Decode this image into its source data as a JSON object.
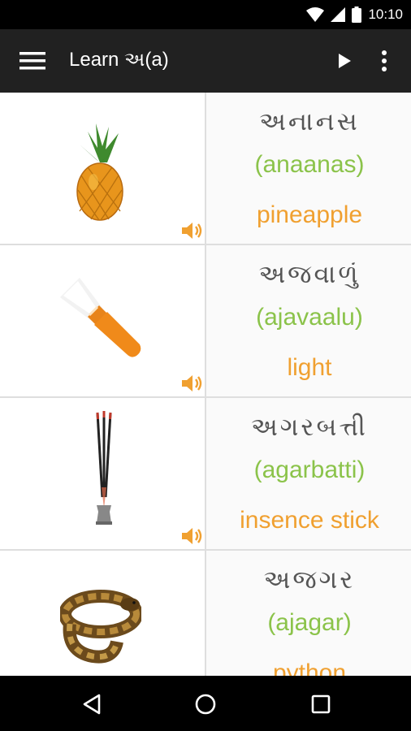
{
  "status_bar": {
    "time": "10:10",
    "icons": [
      "wifi-icon",
      "signal-icon",
      "battery-icon"
    ]
  },
  "app_bar": {
    "title": "Learn અ(a)",
    "actions": [
      "menu-icon",
      "play-icon",
      "more-vert-icon"
    ]
  },
  "words": [
    {
      "gujarati": "અનાનસ",
      "transliteration": "(anaanas)",
      "english": "pineapple",
      "image": "pineapple"
    },
    {
      "gujarati": "અજવાળું",
      "transliteration": "(ajavaalu)",
      "english": "light",
      "image": "flashlight"
    },
    {
      "gujarati": "અગરબત્તી",
      "transliteration": "(agarbatti)",
      "english": "insence stick",
      "image": "incense-sticks"
    },
    {
      "gujarati": "અજગર",
      "transliteration": "(ajagar)",
      "english": "python",
      "image": "python-snake"
    }
  ],
  "colors": {
    "status_bar": "#000000",
    "app_bar": "#212121",
    "gujarati_text": "#555555",
    "transliteration": "#8bc34a",
    "english": "#f0a030",
    "speaker": "#f0a030"
  },
  "nav_bar": {
    "buttons": [
      "back-icon",
      "home-icon",
      "recents-icon"
    ]
  }
}
